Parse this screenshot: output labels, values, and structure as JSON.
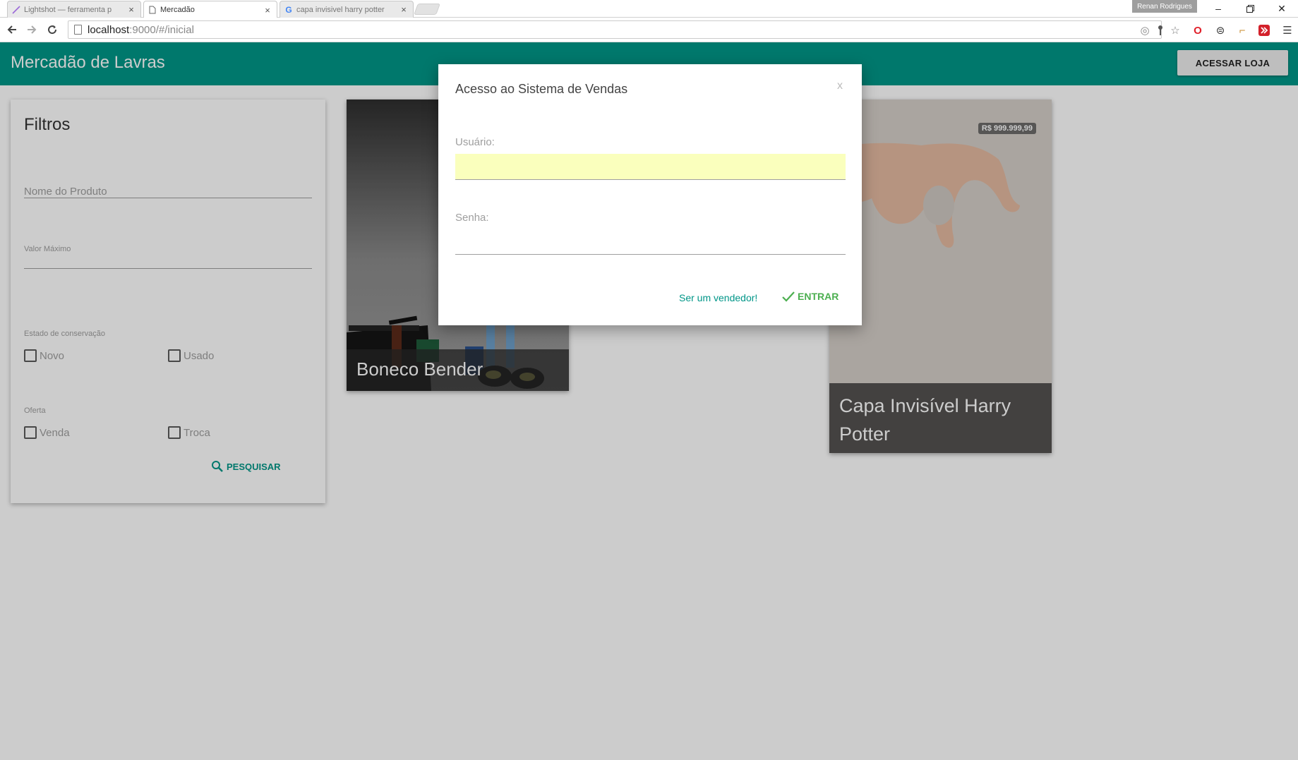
{
  "browser": {
    "tabs": [
      {
        "title": "Lightshot — ferramenta p",
        "icon": "feather-icon",
        "active": false
      },
      {
        "title": "Mercadão",
        "icon": "page-icon",
        "active": true
      },
      {
        "title": "capa invisivel harry potter",
        "icon": "google-icon",
        "active": false
      }
    ],
    "profile_name": "Renan Rodrigues",
    "url_host": "localhost",
    "url_rest": ":9000/#/inicial"
  },
  "app": {
    "title": "Mercadão de Lavras",
    "store_button": "ACESSAR LOJA",
    "accent_color": "#009688"
  },
  "filters": {
    "heading": "Filtros",
    "product_name_placeholder": "Nome do Produto",
    "max_value_label": "Valor Máximo",
    "condition_label": "Estado de conservação",
    "condition_new": "Novo",
    "condition_used": "Usado",
    "offer_label": "Oferta",
    "offer_sale": "Venda",
    "offer_trade": "Troca",
    "search_button": "PESQUISAR"
  },
  "products": [
    {
      "name": "Boneco Bender",
      "price": ""
    },
    {
      "name": "Capa Invisível Harry Potter",
      "price": "R$ 999.999,99"
    }
  ],
  "login_modal": {
    "title": "Acesso ao Sistema de Vendas",
    "close": "x",
    "user_label": "Usuário:",
    "password_label": "Senha:",
    "seller_link": "Ser um vendedor!",
    "enter_button": "ENTRAR"
  }
}
